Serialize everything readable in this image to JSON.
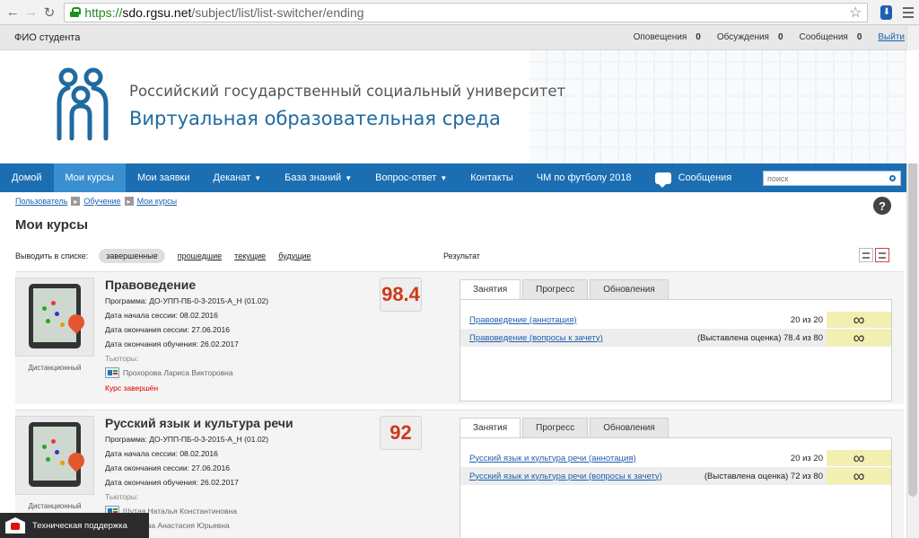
{
  "browser": {
    "url_scheme": "https://",
    "url_host": "sdo.rgsu.net",
    "url_path": "/subject/list/list-switcher/ending"
  },
  "user_bar": {
    "student_name": "ФИО студента",
    "alerts_label": "Оповещения",
    "alerts_count": "0",
    "discussions_label": "Обсуждения",
    "discussions_count": "0",
    "messages_label": "Сообщения",
    "messages_count": "0",
    "logout_label": "Выйти"
  },
  "header": {
    "university": "Российский государственный социальный университет",
    "environment": "Виртуальная образовательная среда"
  },
  "nav": {
    "items": [
      {
        "label": "Домой"
      },
      {
        "label": "Мои курсы"
      },
      {
        "label": "Мои заявки"
      },
      {
        "label": "Деканат"
      },
      {
        "label": "База знаний"
      },
      {
        "label": "Вопрос-ответ"
      },
      {
        "label": "Контакты"
      },
      {
        "label": "ЧМ по футболу 2018"
      },
      {
        "label": "Сообщения"
      }
    ],
    "search_placeholder": "поиск"
  },
  "breadcrumb": [
    "Пользователь",
    "Обучение",
    "Мои курсы"
  ],
  "page_title": "Мои курсы",
  "filter": {
    "label": "Выводить в списке:",
    "options": [
      "завершенные",
      "прошедшие",
      "текущие",
      "будущие"
    ],
    "result_label": "Результат"
  },
  "courses": [
    {
      "title": "Правоведение",
      "program": "Программа: ДО-УПП-ПБ-0-3-2015-А_Н (01.02)",
      "session_start": "Дата начала сессии: 08.02.2016",
      "session_end": "Дата окончания сессии: 27.06.2016",
      "study_end": "Дата окончания обучения: 26.02.2017",
      "tutors_label": "Тьюторы:",
      "tutors": [
        "Прохорова Лариса Викторовна"
      ],
      "status": "Курс завершён",
      "thumb_caption": "Дистанционный",
      "score": "98.4",
      "tabs": [
        "Занятия",
        "Прогресс",
        "Обновления"
      ],
      "lessons": [
        {
          "title": "Правоведение (аннотация)",
          "result": "20 из 20",
          "mark": "∞"
        },
        {
          "title": "Правоведение (вопросы к зачету)",
          "result": "(Выставлена оценка) 78.4 из 80",
          "mark": "∞"
        }
      ]
    },
    {
      "title": "Русский язык и культура речи",
      "program": "Программа: ДО-УПП-ПБ-0-3-2015-А_Н (01.02)",
      "session_start": "Дата начала сессии: 08.02.2016",
      "session_end": "Дата окончания сессии: 27.06.2016",
      "study_end": "Дата окончания обучения: 26.02.2017",
      "tutors_label": "Тьюторы:",
      "tutors": [
        "Шутая Наталья Константиновна",
        "Пугачёва Анастасия Юрьевна"
      ],
      "thumb_caption": "Дистанционный",
      "score": "92",
      "tabs": [
        "Занятия",
        "Прогресс",
        "Обновления"
      ],
      "lessons": [
        {
          "title": "Русский язык и культура речи (аннотация)",
          "result": "20 из 20",
          "mark": "∞"
        },
        {
          "title": "Русский язык и культура речи (вопросы к зачету)",
          "result": "(Выставлена оценка) 72 из 80",
          "mark": "∞"
        }
      ]
    }
  ],
  "support": {
    "label": "Техническая поддержка"
  }
}
